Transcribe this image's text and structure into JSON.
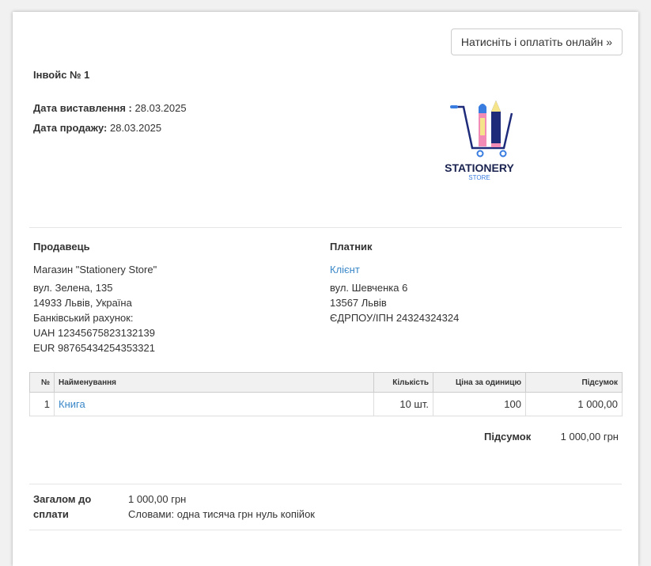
{
  "pay_button": "Натисніть і оплатіть онлайн »",
  "invoice_title": "Інвойс № 1",
  "issue_label": "Дата виставлення :",
  "issue_date": "28.03.2025",
  "sale_label": "Дата продажу:",
  "sale_date": "28.03.2025",
  "logo": {
    "name": "STATIONERY",
    "sub": "STORE"
  },
  "seller": {
    "heading": "Продавець",
    "name": "Магазин \"Stationery Store\"",
    "street": "вул. Зелена, 135",
    "city": "14933 Львів, Україна",
    "bank_label": "Банківський рахунок:",
    "uah": "UAH 12345675823132139",
    "eur": "EUR 98765434254353321"
  },
  "payer": {
    "heading": "Платник",
    "name": "Клієнт",
    "street": "вул. Шевченка 6",
    "city": "13567 Львів",
    "tax": "ЄДРПОУ/ІПН 24324324324"
  },
  "table": {
    "headers": [
      "№",
      "Найменування",
      "Кількість",
      "Ціна за одиницю",
      "Підсумок"
    ],
    "rows": [
      {
        "n": "1",
        "name": "Книга",
        "qty": "10 шт.",
        "price": "100",
        "total": "1 000,00"
      }
    ]
  },
  "subtotal_label": "Підсумок",
  "subtotal_value": "1 000,00 грн",
  "grand_label": "Загалом до сплати",
  "grand_value": "1 000,00 грн",
  "words": "Словами: одна тисяча грн нуль копійок"
}
